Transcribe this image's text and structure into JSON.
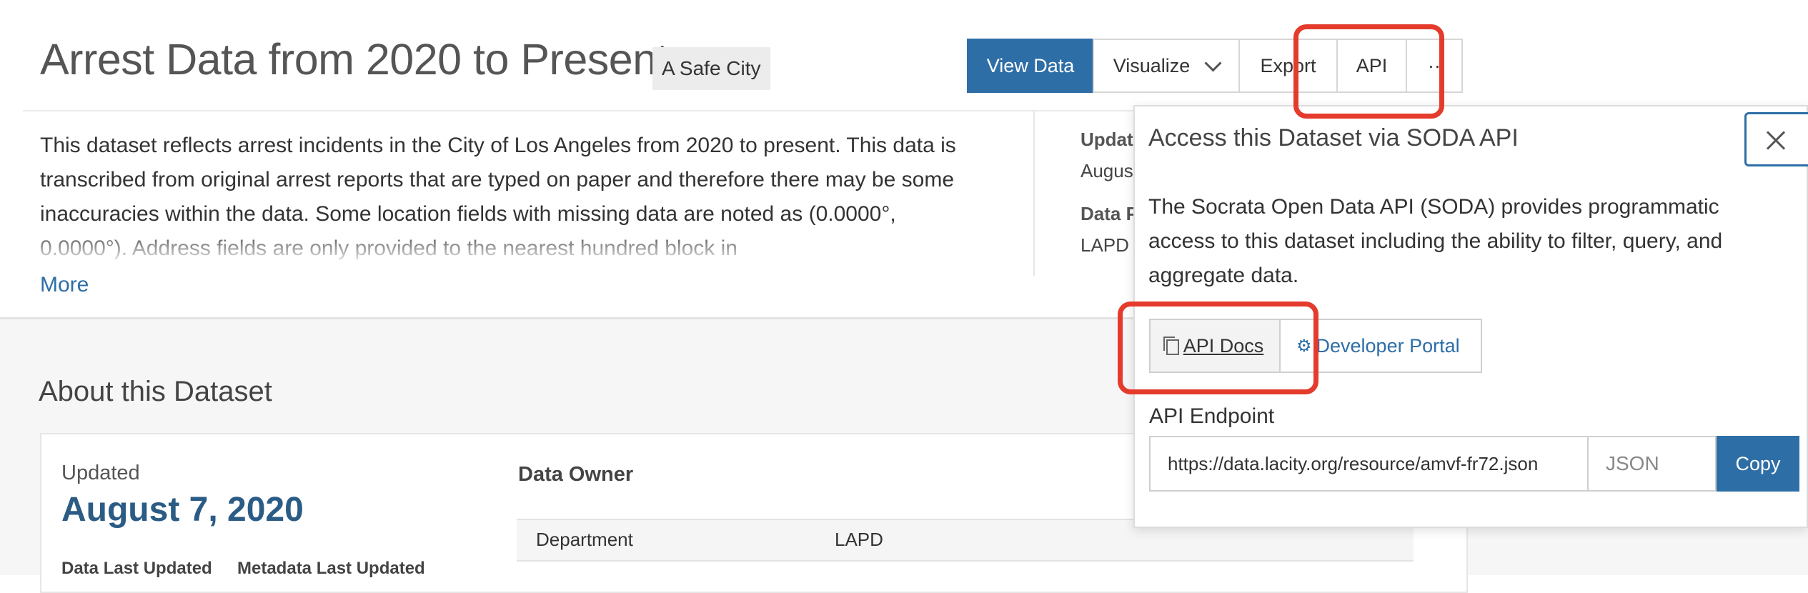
{
  "header": {
    "title": "Arrest Data from 2020 to Present",
    "category_tag": "A Safe City"
  },
  "toolbar": {
    "view_data": "View Data",
    "visualize": "Visualize",
    "export": "Export",
    "api": "API",
    "more": "··"
  },
  "description": {
    "text": "This dataset reflects arrest incidents in the City of Los Angeles from 2020 to present. This data is transcribed from original arrest reports that are typed on paper and therefore there may be some inaccuracies within the data. Some location fields with missing data are noted as (0.0000°, 0.0000°). Address fields are only provided to the nearest hundred block in",
    "more_link": "More"
  },
  "side_panel": {
    "label1": "Updat",
    "value1": "Augus",
    "label2": "Data P",
    "value2": "LAPD"
  },
  "about": {
    "title": "About this Dataset",
    "updated_label": "Updated",
    "updated_date": "August 7, 2020",
    "data_last_updated": "Data Last Updated",
    "metadata_last_updated": "Metadata Last Updated",
    "owner_title": "Data Owner",
    "owner_key": "Department",
    "owner_value": "LAPD"
  },
  "api_popover": {
    "title": "Access this Dataset via SODA API",
    "description": "The Socrata Open Data API (SODA) provides programmatic access to this dataset including the ability to filter, query, and aggregate data.",
    "api_docs": "API Docs",
    "developer_portal": "Developer Portal",
    "endpoint_label": "API Endpoint",
    "endpoint_value": "https://data.lacity.org/resource/amvf-fr72.json",
    "format_selected": "JSON",
    "copy": "Copy"
  },
  "colors": {
    "primary": "#2e6ea6",
    "highlight": "#e53b2c",
    "date": "#2b5c85"
  },
  "icons": {
    "close": "close-icon",
    "chevron": "chevron-down-icon",
    "api_docs": "copy-icon",
    "developer_portal": "gear-icon"
  }
}
